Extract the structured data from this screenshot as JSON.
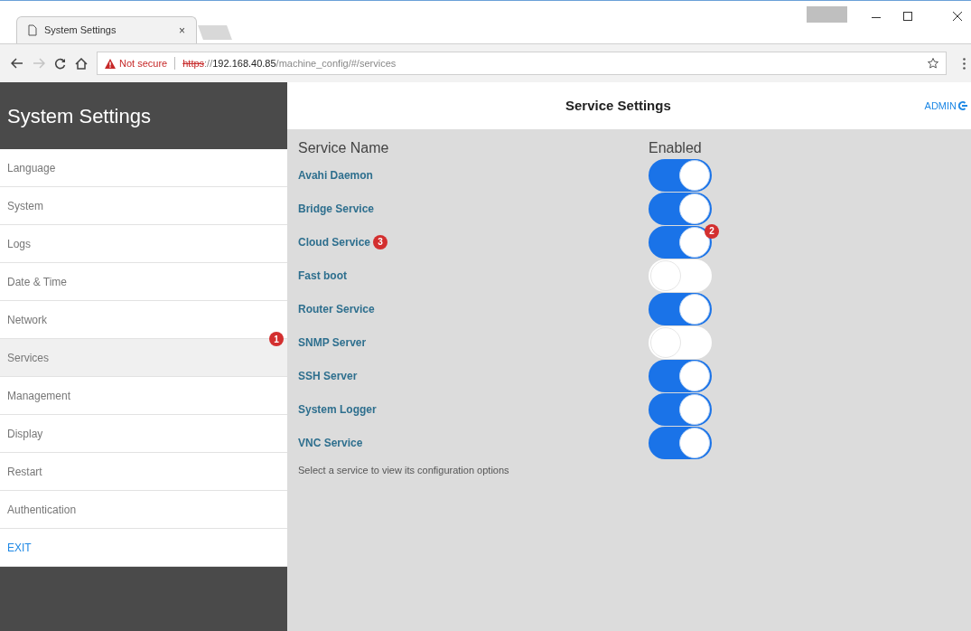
{
  "browser": {
    "tab_title": "System Settings",
    "tab_close": "×",
    "security": "Not secure",
    "url": {
      "scheme": "https",
      "separator": "://",
      "host": "192.168.40.85",
      "path": "/machine_config/#/services"
    }
  },
  "sidebar": {
    "title": "System Settings",
    "items": [
      {
        "label": "Language",
        "selected": false,
        "kind": "item"
      },
      {
        "label": "System",
        "selected": false,
        "kind": "item"
      },
      {
        "label": "Logs",
        "selected": false,
        "kind": "item"
      },
      {
        "label": "Date & Time",
        "selected": false,
        "kind": "item"
      },
      {
        "label": "Network",
        "selected": false,
        "kind": "item"
      },
      {
        "label": "Services",
        "selected": true,
        "kind": "item",
        "badge": "1"
      },
      {
        "label": "Management",
        "selected": false,
        "kind": "item"
      },
      {
        "label": "Display",
        "selected": false,
        "kind": "item"
      },
      {
        "label": "Restart",
        "selected": false,
        "kind": "item"
      },
      {
        "label": "Authentication",
        "selected": false,
        "kind": "item"
      },
      {
        "label": "EXIT",
        "selected": false,
        "kind": "exit"
      }
    ]
  },
  "header": {
    "title": "Service Settings",
    "user": "ADMIN"
  },
  "table": {
    "columns": [
      "Service Name",
      "Enabled"
    ],
    "rows": [
      {
        "name": "Avahi Daemon",
        "on": true
      },
      {
        "name": "Bridge Service",
        "on": true
      },
      {
        "name": "Cloud Service",
        "on": true,
        "name_badge": "3",
        "toggle_badge": "2"
      },
      {
        "name": "Fast boot",
        "on": false
      },
      {
        "name": "Router Service",
        "on": true
      },
      {
        "name": "SNMP Server",
        "on": false
      },
      {
        "name": "SSH Server",
        "on": true
      },
      {
        "name": "System Logger",
        "on": true
      },
      {
        "name": "VNC Service",
        "on": true
      }
    ]
  },
  "hint": "Select a service to view its configuration options"
}
